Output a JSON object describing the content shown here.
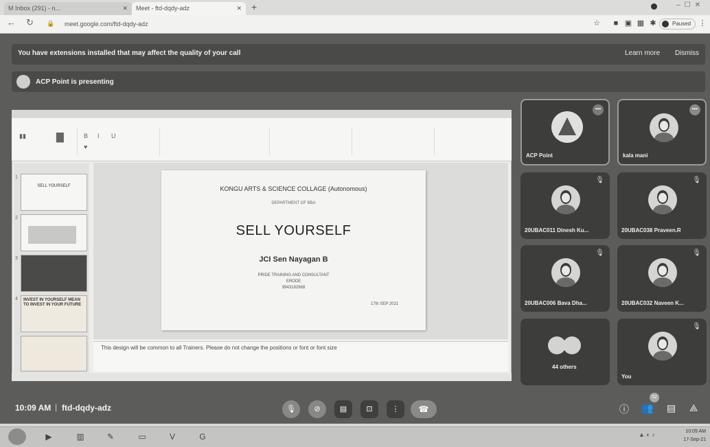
{
  "browser": {
    "tabs": [
      {
        "label": "M Inbox (291) - n..."
      },
      {
        "label": "Meet - ftd-dqdy-adz"
      }
    ],
    "new_tab": "+",
    "url": "meet.google.com/ftd-dqdy-adz",
    "profile_label": "Paused"
  },
  "banner": {
    "text": "You have extensions installed that may affect the quality of your call",
    "learn_more": "Learn more",
    "dismiss": "Dismiss"
  },
  "presenting": {
    "text": "ACP Point is presenting"
  },
  "presentation": {
    "slide": {
      "college": "KONGU ARTS & SCIENCE COLLAGE (Autonomous)",
      "department": "DEPARTMENT OF BBA",
      "title": "SELL YOURSELF",
      "presenter": "JCI Sen Nayagan B",
      "org_line1": "PRIDE TRAINING AND CONSULTANT",
      "org_line2": "ERODE",
      "org_line3": "9943182968",
      "date": "17th SEP 2021"
    },
    "notes": "This design will be common to all Trainers. Please do not change the positions or font or font size",
    "thumbnails": [
      {
        "num": "1",
        "text": "SELL YOURSELF"
      },
      {
        "num": "2",
        "text": ""
      },
      {
        "num": "3",
        "text": ""
      },
      {
        "num": "4",
        "text": "INVEST IN YOURSELF MEAN TO INVEST IN YOUR FUTURE"
      }
    ]
  },
  "participants": [
    {
      "name": "ACP Point"
    },
    {
      "name": "kala mani"
    },
    {
      "name": "20UBAC011 Dinesh Ku..."
    },
    {
      "name": "20UBAC038 Praveen.R"
    },
    {
      "name": "20UBAC006 Bava Dha..."
    },
    {
      "name": "20UBAC032 Naveen K..."
    },
    {
      "name": "44 others"
    },
    {
      "name": "You"
    }
  ],
  "meeting": {
    "time": "10:09 AM",
    "separator": "|",
    "code": "ftd-dqdy-adz",
    "participant_badge": "52"
  },
  "taskbar": {
    "clock_time": "10:09 AM",
    "clock_date": "17-Sep-21"
  },
  "colors": {
    "meet_bg": "#5c5d5b",
    "tile_bg": "#3d3e3c",
    "banner_bg": "#4a4b49"
  }
}
